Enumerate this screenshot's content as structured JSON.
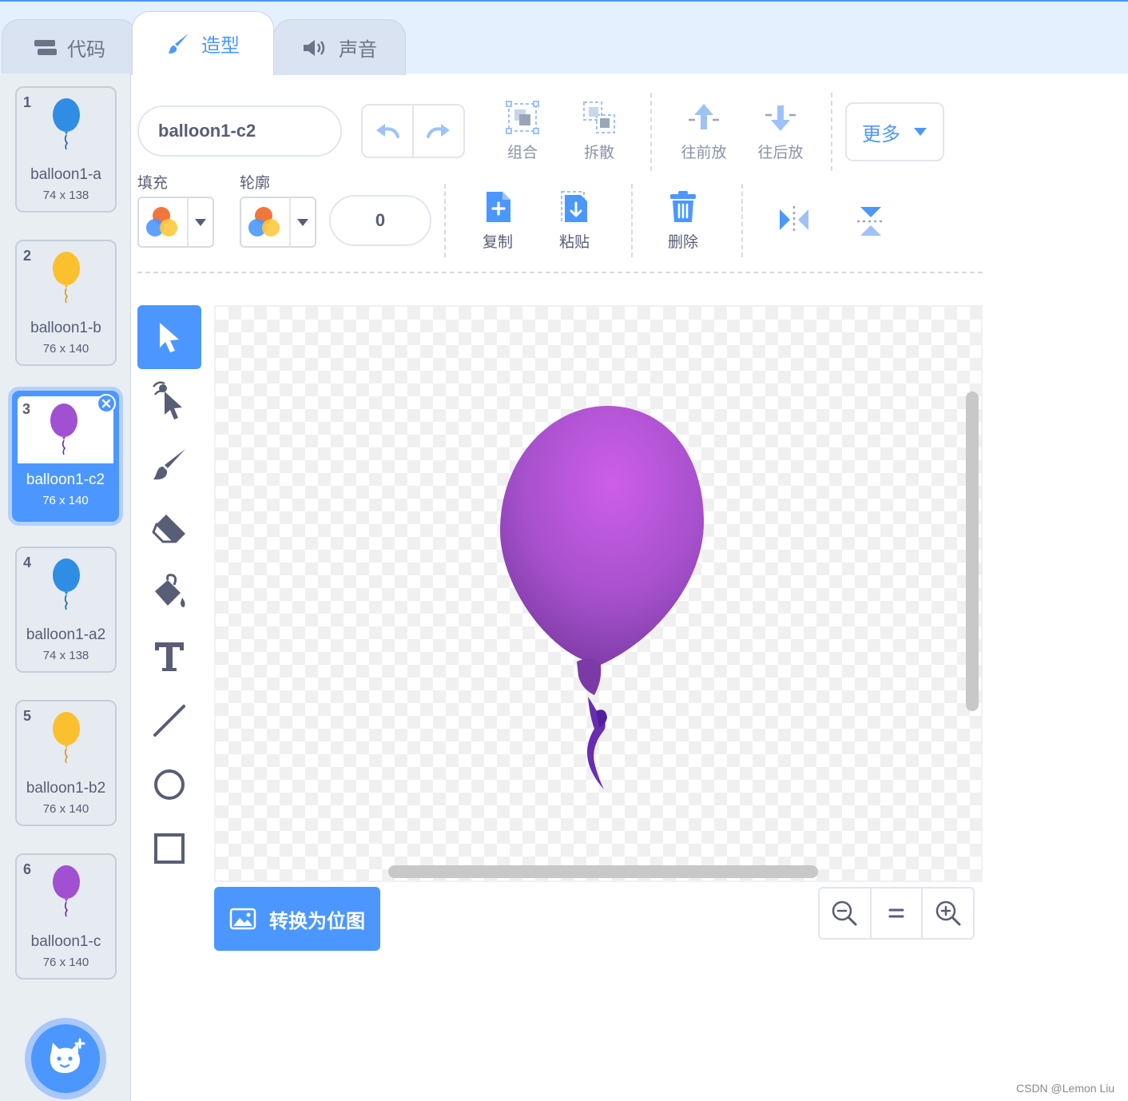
{
  "tabs": [
    {
      "label": "代码",
      "icon": "code-blocks-icon"
    },
    {
      "label": "造型",
      "icon": "paintbrush-icon",
      "active": true
    },
    {
      "label": "声音",
      "icon": "speaker-icon"
    }
  ],
  "costumes": [
    {
      "num": "1",
      "name": "balloon1-a",
      "size": "74 x 138",
      "color": "#2f8de4"
    },
    {
      "num": "2",
      "name": "balloon1-b",
      "size": "76 x 140",
      "color": "#fbc02d"
    },
    {
      "num": "3",
      "name": "balloon1-c2",
      "size": "76 x 140",
      "color": "#a050d0",
      "selected": true
    },
    {
      "num": "4",
      "name": "balloon1-a2",
      "size": "74 x 138",
      "color": "#2f8de4"
    },
    {
      "num": "5",
      "name": "balloon1-b2",
      "size": "76 x 140",
      "color": "#fbc02d"
    },
    {
      "num": "6",
      "name": "balloon1-c",
      "size": "76 x 140",
      "color": "#a050d0"
    }
  ],
  "toolbar": {
    "costume_name": "balloon1-c2",
    "group_label": "组合",
    "ungroup_label": "拆散",
    "forward_label": "往前放",
    "backward_label": "往后放",
    "more_label": "更多",
    "fill_label": "填充",
    "outline_label": "轮廓",
    "stroke_width": "0",
    "copy_label": "复制",
    "paste_label": "粘贴",
    "delete_label": "删除"
  },
  "convert_label": "转换为位图",
  "watermark": "CSDN @Lemon Liu",
  "colors": {
    "accent": "#4c97ff",
    "balloon": "#a050d0"
  }
}
